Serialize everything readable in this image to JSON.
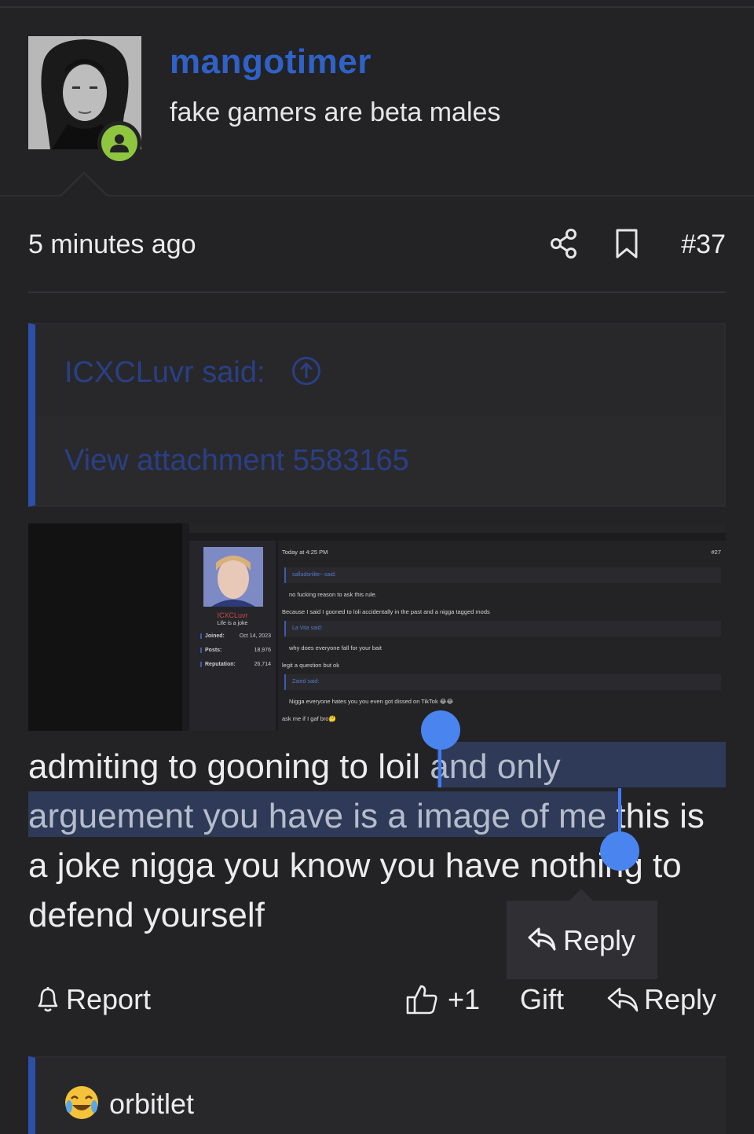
{
  "post": {
    "username": "mangotimer",
    "user_title": "fake gamers are beta males",
    "timestamp": "5 minutes ago",
    "post_number": "#37",
    "quote": {
      "author": "ICXCLuvr said:",
      "attachment": "View attachment 5583165"
    },
    "body_lines": [
      "admiting to gooning to loil and only",
      "arguement you have is a image of me this is",
      "a joke nigga you know you have nothing to",
      "defend yourself"
    ],
    "body_segments": {
      "line1_a": "admiting to gooning to loil ",
      "line1_b": "and only",
      "line2_a": "arguement you have is a image of me",
      "line2_b": " this is",
      "line3": "a joke nigga you know you have nothing to",
      "line4": "defend yourself"
    }
  },
  "embedded_screenshot": {
    "timestamp": "Today at 4:25 PM",
    "post_number": "#27",
    "profile_name": "ICXCLuvr",
    "profile_title": "Life is a joke",
    "stats": [
      {
        "label": "Joined:",
        "value": "Oct 14, 2023"
      },
      {
        "label": "Posts:",
        "value": "18,976"
      },
      {
        "label": "Reputation:",
        "value": "26,714"
      }
    ],
    "lines": {
      "q1_author": "salludonlite~ said:",
      "q1_text": "no fucking reason to ask this rule.",
      "reply1": "Because I said I gooned to loli accidentally in the past and a nigga tagged mods",
      "q2_author": "La Vita said:",
      "q2_text": "why does everyone fall for your bait",
      "reply2": "legit a question but ok",
      "q3_author": "Zaied said:",
      "q3_text": "Nigga everyone hates you you even got dissed on TikTok 😂😂",
      "reply3": "ask me if I gaf bro🤔"
    }
  },
  "selection_popup": {
    "label": "Reply"
  },
  "actions": {
    "report": "Report",
    "like": "+1",
    "gift": "Gift",
    "reply": "Reply"
  },
  "next_post": {
    "username": "orbitlet"
  },
  "colors": {
    "background": "#232325",
    "username": "#2f62c7",
    "online": "#8ec63f",
    "quote_accent": "#2d4fa8",
    "selection": "#2e3a57",
    "handle": "#4a84ee"
  },
  "icons": [
    "user-online-icon",
    "share-icon",
    "bookmark-icon",
    "arrow-up-circle-icon",
    "reply-icon",
    "bell-icon",
    "thumbs-up-icon",
    "crying-laughing-emoji-icon"
  ]
}
